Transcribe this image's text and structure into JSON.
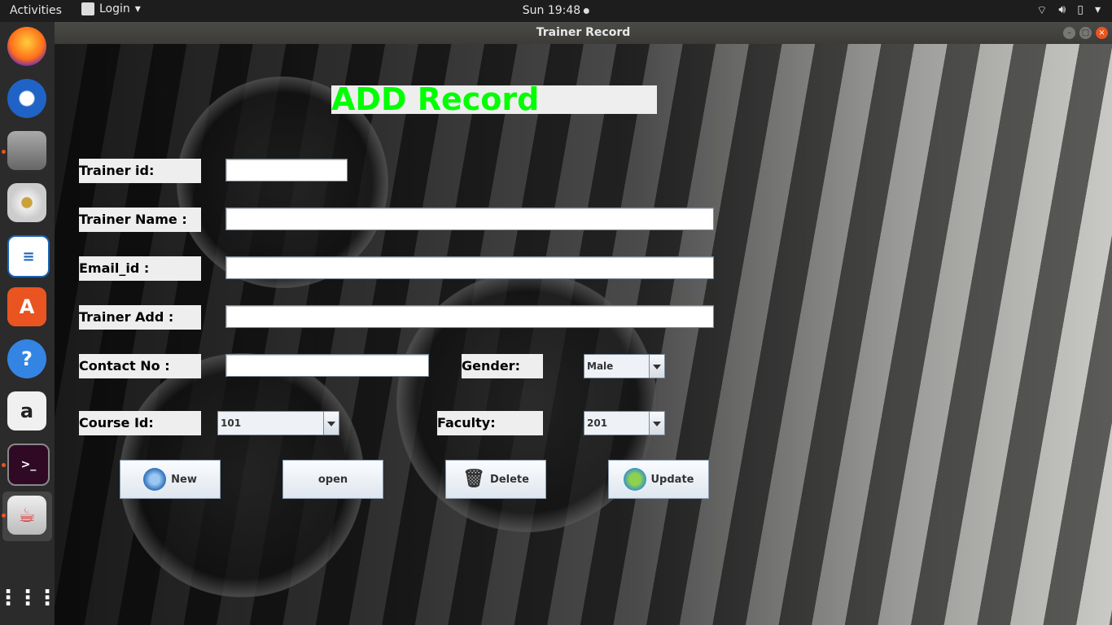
{
  "topbar": {
    "activities": "Activities",
    "app_menu": "Login",
    "clock": "Sun 19:48"
  },
  "window": {
    "title": "Trainer  Record"
  },
  "form": {
    "heading": "ADD Record",
    "trainer_id_label": "Trainer id:",
    "trainer_name_label": "Trainer Name :",
    "email_label": "Email_id :",
    "trainer_add_label": "Trainer Add :",
    "contact_label": "Contact No :",
    "gender_label": "Gender:",
    "gender_value": "Male",
    "course_label": "Course Id:",
    "course_value": "101",
    "faculty_label": "Faculty:",
    "faculty_value": "201",
    "trainer_id_value": "",
    "trainer_name_value": "",
    "email_value": "",
    "trainer_add_value": "",
    "contact_value": ""
  },
  "buttons": {
    "new": "New",
    "open": "open",
    "delete": "Delete",
    "update": "Update"
  },
  "colors": {
    "heading_text": "#00ff00",
    "dock_bg": "#2b2b2b",
    "topbar_bg": "#1d1d1d"
  },
  "dock": {
    "items": [
      "firefox-icon",
      "thunderbird-icon",
      "files-icon",
      "rhythmbox-icon",
      "writer-icon",
      "software-icon",
      "help-icon",
      "amazon-icon",
      "terminal-icon",
      "java-icon",
      "show-apps-icon"
    ]
  }
}
